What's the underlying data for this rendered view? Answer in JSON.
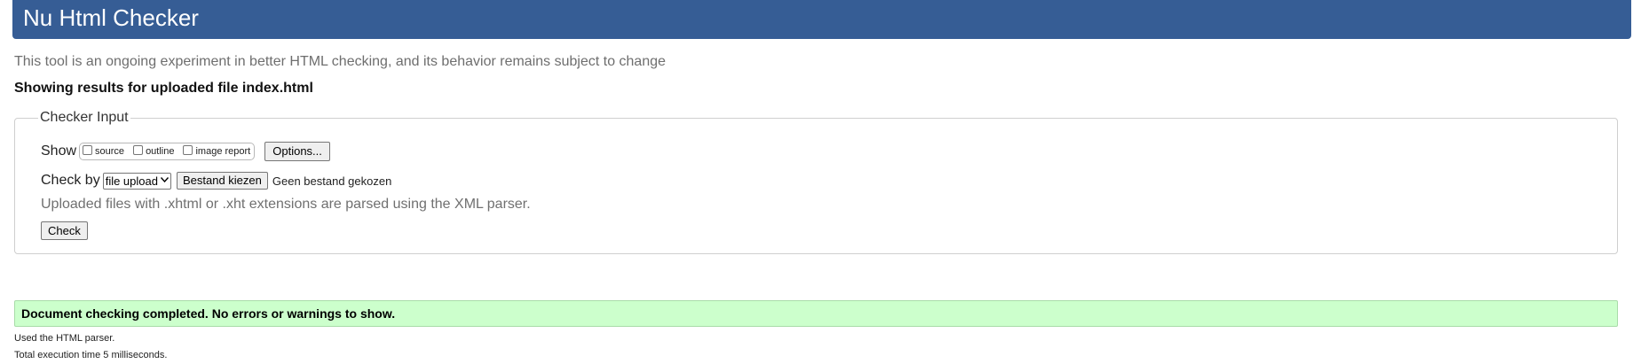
{
  "header": {
    "title": "Nu Html Checker"
  },
  "intro": "This tool is an ongoing experiment in better HTML checking, and its behavior remains subject to change",
  "results_heading": "Showing results for uploaded file index.html",
  "checker_input": {
    "legend": "Checker Input",
    "show_label": "Show",
    "show_options": [
      {
        "label": "source",
        "checked": false
      },
      {
        "label": "outline",
        "checked": false
      },
      {
        "label": "image report",
        "checked": false
      }
    ],
    "options_button": "Options...",
    "check_by_label": "Check by",
    "check_by_selected": "file upload",
    "choose_file_button": "Bestand kiezen",
    "no_file_text": "Geen bestand gekozen",
    "xml_note": "Uploaded files with .xhtml or .xht extensions are parsed using the XML parser.",
    "check_button": "Check"
  },
  "result": {
    "message": "Document checking completed. No errors or warnings to show."
  },
  "stats": {
    "parser": "Used the HTML parser.",
    "time": "Total execution time 5 milliseconds."
  },
  "colors": {
    "header_bg": "#365d95",
    "success_bg": "#ccffcc",
    "muted_text": "#707070"
  },
  "icons": {
    "select_arrow": "chevron-down-icon"
  }
}
